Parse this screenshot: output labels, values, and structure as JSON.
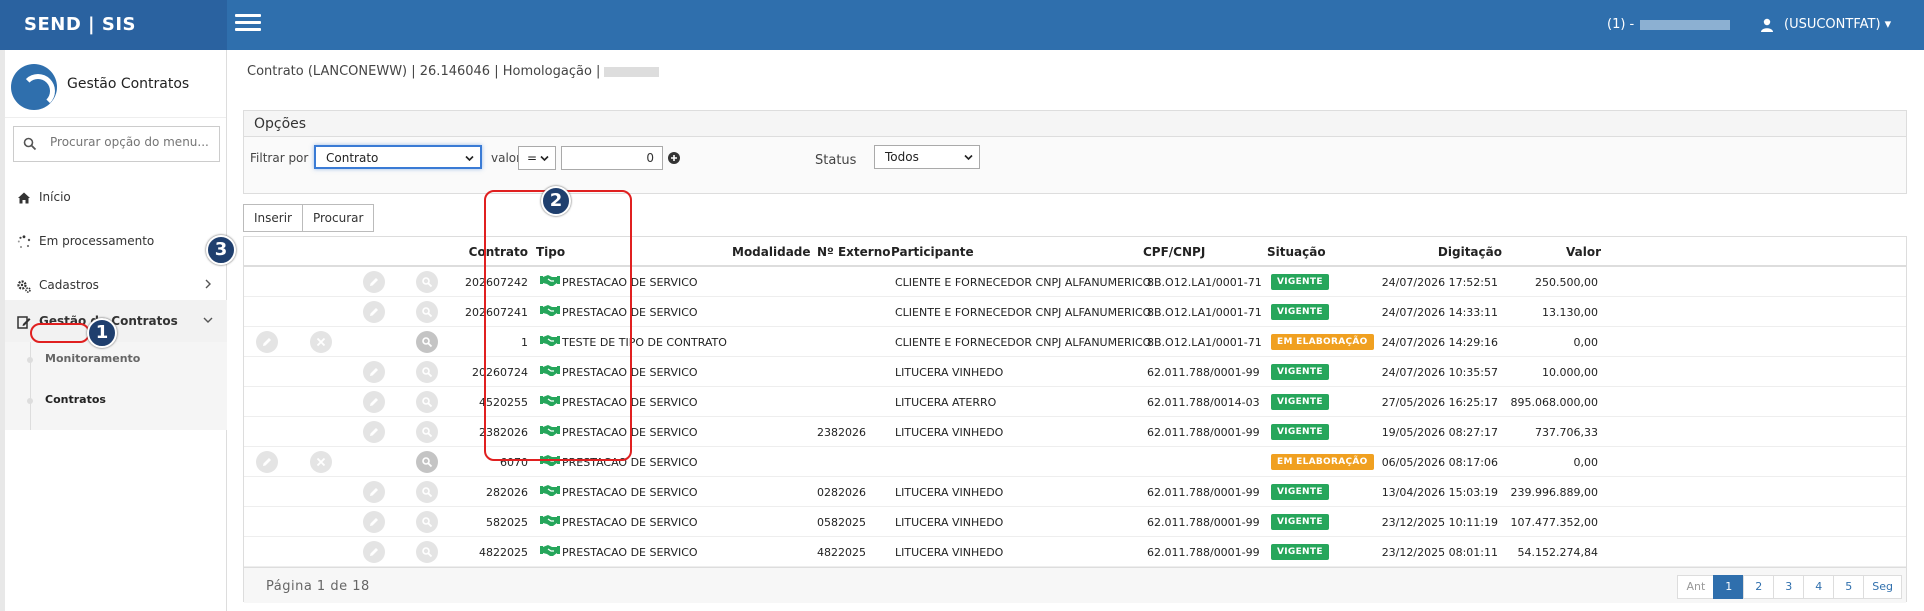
{
  "brand": "SEND | SIS",
  "topbar": {
    "count_label": "(1) -",
    "user_label": "(USUCONTFAT) ▾"
  },
  "sidebar": {
    "title": "Gestão Contratos",
    "search_placeholder": "Procurar opção do menu...",
    "items": [
      {
        "label": "Início"
      },
      {
        "label": "Em processamento"
      },
      {
        "label": "Cadastros"
      },
      {
        "label": "Gestão de Contratos"
      }
    ],
    "subitems": [
      {
        "label": "Monitoramento"
      },
      {
        "label": "Contratos"
      }
    ]
  },
  "breadcrumb": "Contrato (LANCONEWW) | 26.146046 | Homologação |",
  "options": {
    "title": "Opções",
    "filter_label": "Filtrar por",
    "filter_value": "Contrato",
    "valor_label": "valor",
    "operator": "=",
    "number_value": "0",
    "status_label": "Status",
    "status_value": "Todos"
  },
  "buttons": {
    "insert": "Inserir",
    "search": "Procurar"
  },
  "table": {
    "headers": {
      "contrato": "Contrato",
      "tipo": "Tipo",
      "modalidade": "Modalidade",
      "externo": "Nº Externo",
      "participante": "Participante",
      "cpf": "CPF/CNPJ",
      "situacao": "Situação",
      "digitacao": "Digitação",
      "valor": "Valor"
    },
    "rows": [
      {
        "contrato": "202607242",
        "tipo": "PRESTACAO DE SERVICO",
        "externo": "",
        "participante": "CLIENTE E FORNECEDOR CNPJ ALFANUMERICO",
        "cpf": "8B.O12.LA1/0001-71",
        "situacao": "VIGENTE",
        "digitacao": "24/07/2026 17:52:51",
        "valor": "250.500,00",
        "editable": false
      },
      {
        "contrato": "202607241",
        "tipo": "PRESTACAO DE SERVICO",
        "externo": "",
        "participante": "CLIENTE E FORNECEDOR CNPJ ALFANUMERICO",
        "cpf": "8B.O12.LA1/0001-71",
        "situacao": "VIGENTE",
        "digitacao": "24/07/2026 14:33:11",
        "valor": "13.130,00",
        "editable": false
      },
      {
        "contrato": "1",
        "tipo": "TESTE DE TIPO DE CONTRATO",
        "externo": "",
        "participante": "CLIENTE E FORNECEDOR CNPJ ALFANUMERICO",
        "cpf": "8B.O12.LA1/0001-71",
        "situacao": "EM ELABORAÇÃO",
        "digitacao": "24/07/2026 14:29:16",
        "valor": "0,00",
        "editable": true
      },
      {
        "contrato": "20260724",
        "tipo": "PRESTACAO DE SERVICO",
        "externo": "",
        "participante": "LITUCERA VINHEDO",
        "cpf": "62.011.788/0001-99",
        "situacao": "VIGENTE",
        "digitacao": "24/07/2026 10:35:57",
        "valor": "10.000,00",
        "editable": false
      },
      {
        "contrato": "4520255",
        "tipo": "PRESTACAO DE SERVICO",
        "externo": "",
        "participante": "LITUCERA ATERRO",
        "cpf": "62.011.788/0014-03",
        "situacao": "VIGENTE",
        "digitacao": "27/05/2026 16:25:17",
        "valor": "895.068.000,00",
        "editable": false
      },
      {
        "contrato": "2382026",
        "tipo": "PRESTACAO DE SERVICO",
        "externo": "2382026",
        "participante": "LITUCERA VINHEDO",
        "cpf": "62.011.788/0001-99",
        "situacao": "VIGENTE",
        "digitacao": "19/05/2026 08:27:17",
        "valor": "737.706,33",
        "editable": false
      },
      {
        "contrato": "6070",
        "tipo": "PRESTACAO DE SERVICO",
        "externo": "",
        "participante": "",
        "cpf": "",
        "situacao": "EM ELABORAÇÃO",
        "digitacao": "06/05/2026 08:17:06",
        "valor": "0,00",
        "editable": true
      },
      {
        "contrato": "282026",
        "tipo": "PRESTACAO DE SERVICO",
        "externo": "0282026",
        "participante": "LITUCERA VINHEDO",
        "cpf": "62.011.788/0001-99",
        "situacao": "VIGENTE",
        "digitacao": "13/04/2026 15:03:19",
        "valor": "239.996.889,00",
        "editable": false
      },
      {
        "contrato": "582025",
        "tipo": "PRESTACAO DE SERVICO",
        "externo": "0582025",
        "participante": "LITUCERA VINHEDO",
        "cpf": "62.011.788/0001-99",
        "situacao": "VIGENTE",
        "digitacao": "23/12/2025 10:11:19",
        "valor": "107.477.352,00",
        "editable": false
      },
      {
        "contrato": "4822025",
        "tipo": "PRESTACAO DE SERVICO",
        "externo": "4822025",
        "participante": "LITUCERA VINHEDO",
        "cpf": "62.011.788/0001-99",
        "situacao": "VIGENTE",
        "digitacao": "23/12/2025 08:01:11",
        "valor": "54.152.274,84",
        "editable": false
      }
    ]
  },
  "pagination": {
    "info": "Página 1 de 18",
    "prev": "Ant",
    "pages": [
      "1",
      "2",
      "3",
      "4",
      "5"
    ],
    "next": "Seg"
  },
  "annotations": [
    "1",
    "2",
    "3"
  ],
  "colors": {
    "primary": "#2f6fad",
    "vigente": "#26a65b",
    "elaboracao": "#f0a020",
    "annotation": "#e02020"
  }
}
